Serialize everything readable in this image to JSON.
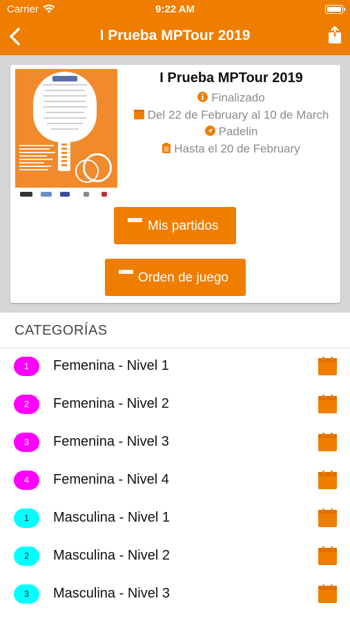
{
  "status_bar": {
    "carrier": "Carrier",
    "time": "9:22 AM"
  },
  "nav": {
    "title": "I Prueba MPTour 2019"
  },
  "event": {
    "title": "I Prueba MPTour 2019",
    "status": "Finalizado",
    "dates": "Del 22 de February al 10 de March",
    "venue": "Padelin",
    "deadline": "Hasta el 20 de February",
    "poster_alt": "Calendario MPTour 2019 poster"
  },
  "buttons": {
    "mis_partidos": "Mis partidos",
    "orden_de_juego": "Orden de juego"
  },
  "section": {
    "categorias_title": "CATEGORÍAS"
  },
  "categories": [
    {
      "number": "1",
      "name": "Femenina - Nivel 1",
      "color": "#ff00ff"
    },
    {
      "number": "2",
      "name": "Femenina - Nivel 2",
      "color": "#ff00ff"
    },
    {
      "number": "3",
      "name": "Femenina - Nivel 3",
      "color": "#ff00ff"
    },
    {
      "number": "4",
      "name": "Femenina - Nivel 4",
      "color": "#ff00ff"
    },
    {
      "number": "1",
      "name": "Masculina - Nivel 1",
      "color": "#00ffff"
    },
    {
      "number": "2",
      "name": "Masculina - Nivel 2",
      "color": "#00ffff"
    },
    {
      "number": "3",
      "name": "Masculina - Nivel 3",
      "color": "#00ffff"
    }
  ],
  "colors": {
    "accent": "#ef7d00",
    "female_badge": "#ff00ff",
    "male_badge": "#00ffff",
    "card_area_bg": "#d6d6d6"
  }
}
